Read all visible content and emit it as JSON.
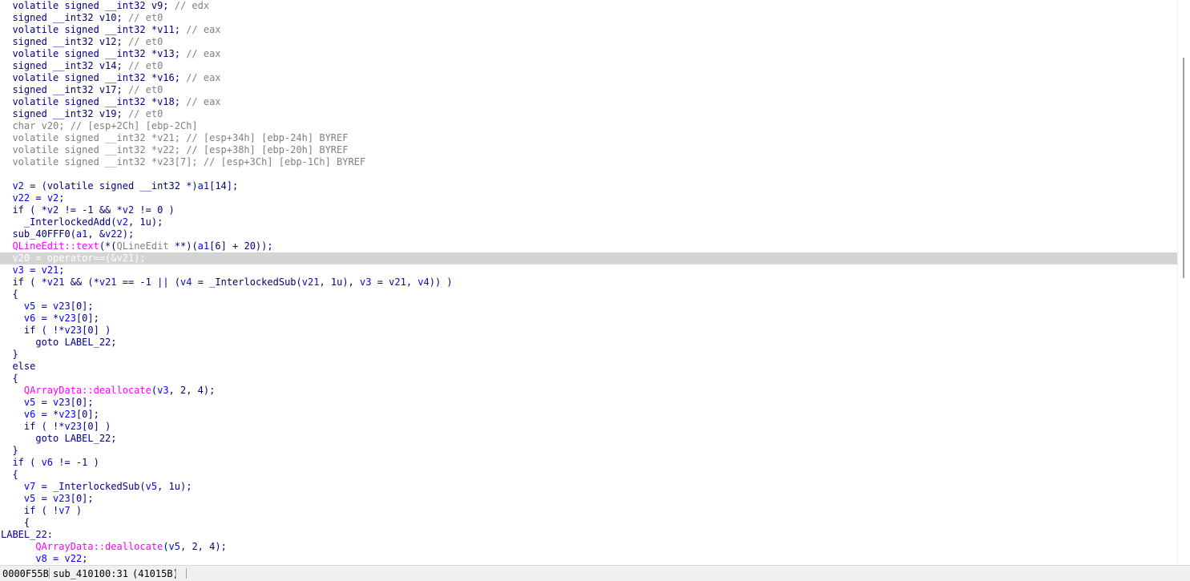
{
  "editor": {
    "lines": [
      {
        "segs": [
          {
            "t": "  volatile signed __int32 v9; ",
            "c": ""
          },
          {
            "t": "// edx",
            "c": "cmt"
          }
        ]
      },
      {
        "segs": [
          {
            "t": "  signed __int32 v10; ",
            "c": ""
          },
          {
            "t": "// et0",
            "c": "cmt"
          }
        ]
      },
      {
        "segs": [
          {
            "t": "  volatile signed __int32 *v11; ",
            "c": ""
          },
          {
            "t": "// eax",
            "c": "cmt"
          }
        ]
      },
      {
        "segs": [
          {
            "t": "  signed __int32 v12; ",
            "c": ""
          },
          {
            "t": "// et0",
            "c": "cmt"
          }
        ]
      },
      {
        "segs": [
          {
            "t": "  volatile signed __int32 *v13; ",
            "c": ""
          },
          {
            "t": "// eax",
            "c": "cmt"
          }
        ]
      },
      {
        "segs": [
          {
            "t": "  signed __int32 v14; ",
            "c": ""
          },
          {
            "t": "// et0",
            "c": "cmt"
          }
        ]
      },
      {
        "segs": [
          {
            "t": "  volatile signed __int32 *v16; ",
            "c": ""
          },
          {
            "t": "// eax",
            "c": "cmt"
          }
        ]
      },
      {
        "segs": [
          {
            "t": "  signed __int32 v17; ",
            "c": ""
          },
          {
            "t": "// et0",
            "c": "cmt"
          }
        ]
      },
      {
        "segs": [
          {
            "t": "  volatile signed __int32 *v18; ",
            "c": ""
          },
          {
            "t": "// eax",
            "c": "cmt"
          }
        ]
      },
      {
        "segs": [
          {
            "t": "  signed __int32 v19; ",
            "c": ""
          },
          {
            "t": "// et0",
            "c": "cmt"
          }
        ]
      },
      {
        "segs": [
          {
            "t": "  char v20; // [esp+2Ch] [ebp-2Ch]",
            "c": "gry"
          }
        ]
      },
      {
        "segs": [
          {
            "t": "  volatile signed __int32 *v21; // [esp+34h] [ebp-24h] BYREF",
            "c": "gry"
          }
        ]
      },
      {
        "segs": [
          {
            "t": "  volatile signed __int32 *v22; // [esp+38h] [ebp-20h] BYREF",
            "c": "gry"
          }
        ]
      },
      {
        "segs": [
          {
            "t": "  volatile signed __int32 *v23[7]; // [esp+3Ch] [ebp-1Ch] BYREF",
            "c": "gry"
          }
        ]
      },
      {
        "segs": [
          {
            "t": "",
            "c": ""
          }
        ]
      },
      {
        "segs": [
          {
            "t": "  ",
            "c": ""
          },
          {
            "t": "v2",
            "c": "var"
          },
          {
            "t": " = (volatile signed __int32 *)",
            "c": ""
          },
          {
            "t": "a1",
            "c": "var"
          },
          {
            "t": "[14];",
            "c": ""
          }
        ]
      },
      {
        "segs": [
          {
            "t": "  ",
            "c": ""
          },
          {
            "t": "v22",
            "c": "var"
          },
          {
            "t": " = ",
            "c": ""
          },
          {
            "t": "v2",
            "c": "var"
          },
          {
            "t": ";",
            "c": ""
          }
        ]
      },
      {
        "segs": [
          {
            "t": "  if ( *",
            "c": ""
          },
          {
            "t": "v2",
            "c": "var"
          },
          {
            "t": " != -1 && *",
            "c": ""
          },
          {
            "t": "v2",
            "c": "var"
          },
          {
            "t": " != 0 )",
            "c": ""
          }
        ]
      },
      {
        "segs": [
          {
            "t": "    _InterlockedAdd(",
            "c": ""
          },
          {
            "t": "v2",
            "c": "var"
          },
          {
            "t": ", 1u);",
            "c": ""
          }
        ]
      },
      {
        "segs": [
          {
            "t": "  sub_40FFF0(",
            "c": ""
          },
          {
            "t": "a1",
            "c": "var"
          },
          {
            "t": ", &",
            "c": ""
          },
          {
            "t": "v22",
            "c": "var"
          },
          {
            "t": ");",
            "c": ""
          }
        ]
      },
      {
        "segs": [
          {
            "t": "  ",
            "c": ""
          },
          {
            "t": "QLineEdit::text",
            "c": "fn"
          },
          {
            "t": "(*(",
            "c": ""
          },
          {
            "t": "QLineEdit",
            "c": "gry"
          },
          {
            "t": " **)(",
            "c": ""
          },
          {
            "t": "a1",
            "c": "var"
          },
          {
            "t": "[6] + 20));",
            "c": ""
          }
        ]
      },
      {
        "hl": true,
        "segs": [
          {
            "t": "  v20 = operator==(&v21);",
            "c": "k"
          }
        ]
      },
      {
        "segs": [
          {
            "t": "  ",
            "c": ""
          },
          {
            "t": "v3",
            "c": "var"
          },
          {
            "t": " = ",
            "c": ""
          },
          {
            "t": "v21",
            "c": "var"
          },
          {
            "t": ";",
            "c": ""
          }
        ]
      },
      {
        "segs": [
          {
            "t": "  if ( *",
            "c": ""
          },
          {
            "t": "v21",
            "c": "var"
          },
          {
            "t": " && (*",
            "c": ""
          },
          {
            "t": "v21",
            "c": "var"
          },
          {
            "t": " == -1 || (",
            "c": ""
          },
          {
            "t": "v4",
            "c": "var"
          },
          {
            "t": " = _InterlockedSub(",
            "c": ""
          },
          {
            "t": "v21",
            "c": "var"
          },
          {
            "t": ", 1u), ",
            "c": ""
          },
          {
            "t": "v3",
            "c": "var"
          },
          {
            "t": " = ",
            "c": ""
          },
          {
            "t": "v21",
            "c": "var"
          },
          {
            "t": ", ",
            "c": ""
          },
          {
            "t": "v4",
            "c": "var"
          },
          {
            "t": ")) )",
            "c": ""
          }
        ]
      },
      {
        "segs": [
          {
            "t": "  {",
            "c": ""
          }
        ]
      },
      {
        "segs": [
          {
            "t": "    ",
            "c": ""
          },
          {
            "t": "v5",
            "c": "var"
          },
          {
            "t": " = ",
            "c": ""
          },
          {
            "t": "v23",
            "c": "var"
          },
          {
            "t": "[0];",
            "c": ""
          }
        ]
      },
      {
        "segs": [
          {
            "t": "    ",
            "c": ""
          },
          {
            "t": "v6",
            "c": "var"
          },
          {
            "t": " = *",
            "c": ""
          },
          {
            "t": "v23",
            "c": "var"
          },
          {
            "t": "[0];",
            "c": ""
          }
        ]
      },
      {
        "segs": [
          {
            "t": "    if ( !*",
            "c": ""
          },
          {
            "t": "v23",
            "c": "var"
          },
          {
            "t": "[0] )",
            "c": ""
          }
        ]
      },
      {
        "segs": [
          {
            "t": "      goto LABEL_22;",
            "c": ""
          }
        ]
      },
      {
        "segs": [
          {
            "t": "  }",
            "c": ""
          }
        ]
      },
      {
        "segs": [
          {
            "t": "  else",
            "c": ""
          }
        ]
      },
      {
        "segs": [
          {
            "t": "  {",
            "c": ""
          }
        ]
      },
      {
        "segs": [
          {
            "t": "    ",
            "c": ""
          },
          {
            "t": "QArrayData::deallocate",
            "c": "fn"
          },
          {
            "t": "(",
            "c": ""
          },
          {
            "t": "v3",
            "c": "var"
          },
          {
            "t": ", 2, 4);",
            "c": ""
          }
        ]
      },
      {
        "segs": [
          {
            "t": "    ",
            "c": ""
          },
          {
            "t": "v5",
            "c": "var"
          },
          {
            "t": " = ",
            "c": ""
          },
          {
            "t": "v23",
            "c": "var"
          },
          {
            "t": "[0];",
            "c": ""
          }
        ]
      },
      {
        "segs": [
          {
            "t": "    ",
            "c": ""
          },
          {
            "t": "v6",
            "c": "var"
          },
          {
            "t": " = *",
            "c": ""
          },
          {
            "t": "v23",
            "c": "var"
          },
          {
            "t": "[0];",
            "c": ""
          }
        ]
      },
      {
        "segs": [
          {
            "t": "    if ( !*",
            "c": ""
          },
          {
            "t": "v23",
            "c": "var"
          },
          {
            "t": "[0] )",
            "c": ""
          }
        ]
      },
      {
        "segs": [
          {
            "t": "      goto LABEL_22;",
            "c": ""
          }
        ]
      },
      {
        "segs": [
          {
            "t": "  }",
            "c": ""
          }
        ]
      },
      {
        "segs": [
          {
            "t": "  if ( ",
            "c": ""
          },
          {
            "t": "v6",
            "c": "var"
          },
          {
            "t": " != -1 )",
            "c": ""
          }
        ]
      },
      {
        "segs": [
          {
            "t": "  {",
            "c": ""
          }
        ]
      },
      {
        "segs": [
          {
            "t": "    ",
            "c": ""
          },
          {
            "t": "v7",
            "c": "var"
          },
          {
            "t": " = _InterlockedSub(",
            "c": ""
          },
          {
            "t": "v5",
            "c": "var"
          },
          {
            "t": ", 1u);",
            "c": ""
          }
        ]
      },
      {
        "segs": [
          {
            "t": "    ",
            "c": ""
          },
          {
            "t": "v5",
            "c": "var"
          },
          {
            "t": " = ",
            "c": ""
          },
          {
            "t": "v23",
            "c": "var"
          },
          {
            "t": "[0];",
            "c": ""
          }
        ]
      },
      {
        "segs": [
          {
            "t": "    if ( !",
            "c": ""
          },
          {
            "t": "v7",
            "c": "var"
          },
          {
            "t": " )",
            "c": ""
          }
        ]
      },
      {
        "segs": [
          {
            "t": "    {",
            "c": ""
          }
        ]
      },
      {
        "segs": [
          {
            "t": "LABEL_22:",
            "c": ""
          }
        ]
      },
      {
        "segs": [
          {
            "t": "      ",
            "c": ""
          },
          {
            "t": "QArrayData::deallocate",
            "c": "fn"
          },
          {
            "t": "(",
            "c": ""
          },
          {
            "t": "v5",
            "c": "var"
          },
          {
            "t": ", 2, 4);",
            "c": ""
          }
        ]
      },
      {
        "segs": [
          {
            "t": "      ",
            "c": ""
          },
          {
            "t": "v8",
            "c": "var"
          },
          {
            "t": " = ",
            "c": ""
          },
          {
            "t": "v22",
            "c": "var"
          },
          {
            "t": ";",
            "c": ""
          }
        ]
      }
    ]
  },
  "statusbar": {
    "address": "0000F55B",
    "location": "sub_410100:31",
    "ea": "(41015B)"
  }
}
